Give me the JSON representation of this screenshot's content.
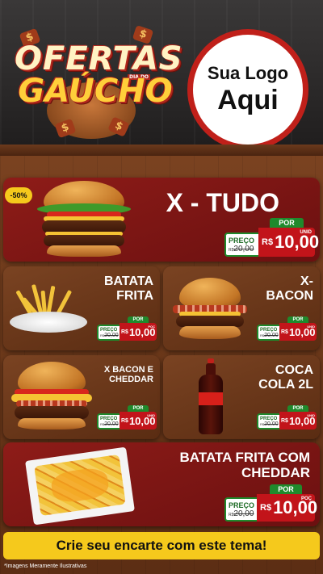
{
  "header": {
    "title_line1": "OFERTAS",
    "title_small": "DIA DO",
    "title_line2": "GAÚCHO",
    "coin_symbol": "$",
    "logo_line1": "Sua Logo",
    "logo_line2": "Aqui"
  },
  "products": [
    {
      "name": "X - TUDO",
      "badge": "-50%",
      "price_label": "PREÇO",
      "old_price": "20,00",
      "old_currency": "R$",
      "por_label": "POR",
      "currency": "R$",
      "price": "10,00",
      "unit": "UNID"
    },
    {
      "name_line1": "BATATA",
      "name_line2": "FRITA",
      "price_label": "PREÇO",
      "old_price": "20,00",
      "old_currency": "R$",
      "por_label": "POR",
      "currency": "R$",
      "price": "10,00",
      "unit": "POÇ"
    },
    {
      "name_line1": "X-",
      "name_line2": "BACON",
      "price_label": "PREÇO",
      "old_price": "20,00",
      "old_currency": "R$",
      "por_label": "POR",
      "currency": "R$",
      "price": "10,00",
      "unit": "UNID"
    },
    {
      "name_line1": "X BACON E",
      "name_line2": "CHEDDAR",
      "price_label": "PREÇO",
      "old_price": "20,00",
      "old_currency": "R$",
      "por_label": "POR",
      "currency": "R$",
      "price": "10,00",
      "unit": "UNID"
    },
    {
      "name_line1": "COCA",
      "name_line2": "COLA 2L",
      "price_label": "PREÇO",
      "old_price": "20,00",
      "old_currency": "R$",
      "por_label": "POR",
      "currency": "R$",
      "price": "10,00",
      "unit": "UNID"
    },
    {
      "name_line1": "BATATA FRITA COM",
      "name_line2": "CHEDDAR",
      "price_label": "PREÇO",
      "old_price": "20,00",
      "old_currency": "R$",
      "por_label": "POR",
      "currency": "R$",
      "price": "10,00",
      "unit": "POÇ"
    }
  ],
  "cta": "Crie seu encarte com este tema!",
  "disclaimer": "*Imagens Meramente Ilustrativas",
  "colors": {
    "red": "#c2141a",
    "green": "#1f8a2c",
    "yellow": "#f5c91c",
    "wood": "#6b3a1c"
  }
}
